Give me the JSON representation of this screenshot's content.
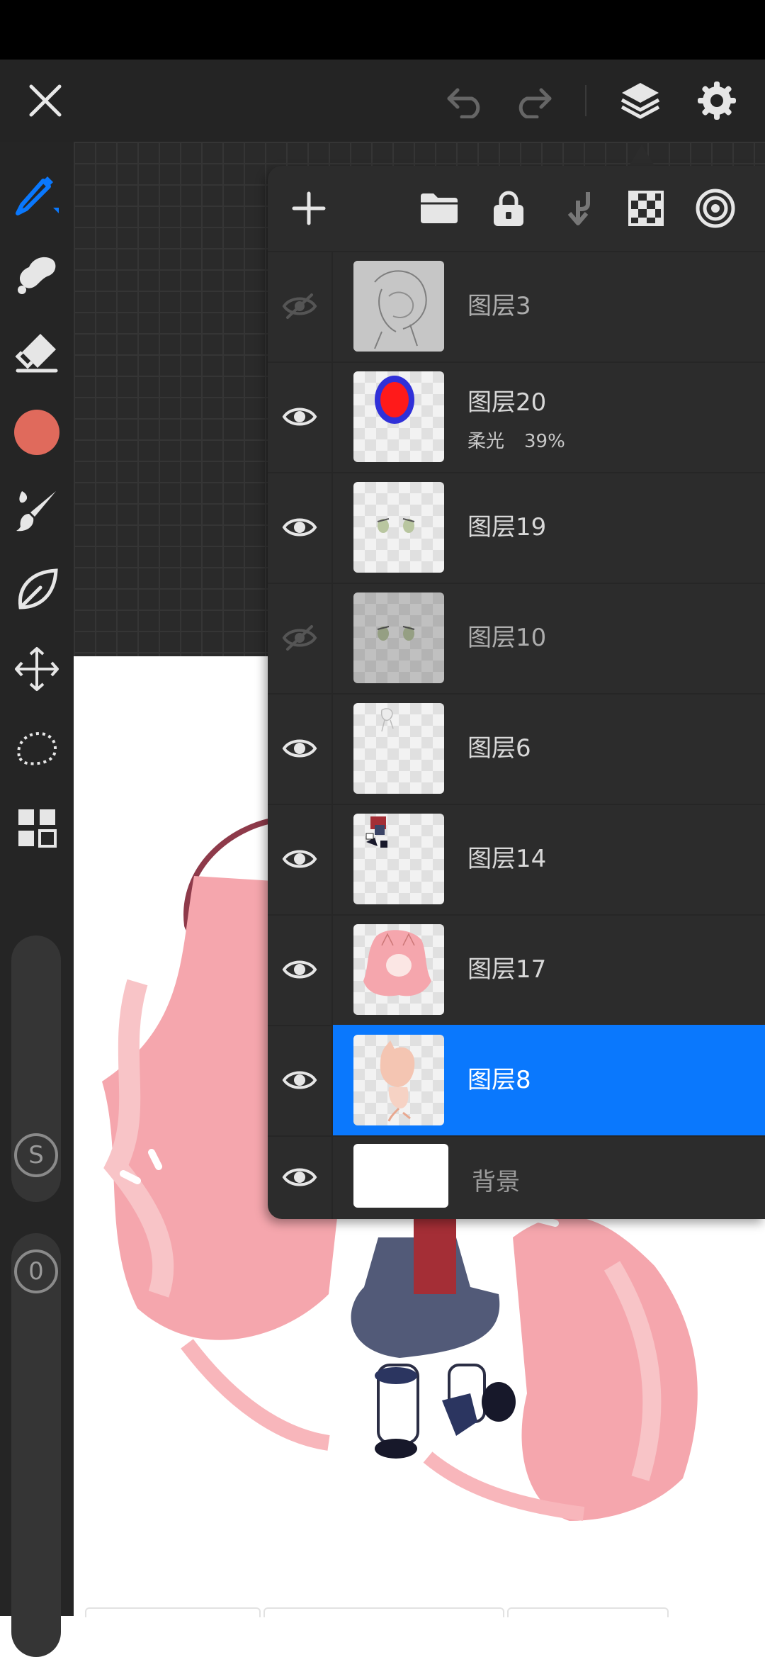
{
  "top_bar": {
    "icons": [
      "close-icon",
      "undo-icon",
      "redo-icon",
      "layers-icon",
      "settings-icon"
    ]
  },
  "left_toolbar": {
    "tools": [
      "pen-icon",
      "smudge-icon",
      "eraser-icon",
      "color-swatch",
      "brush-icon",
      "liquify-icon",
      "move-icon",
      "lasso-icon",
      "gallery-icon"
    ],
    "active_color": "#e06a5c",
    "accent_color": "#0a78fd",
    "size_knob": "S",
    "opacity_knob": "0"
  },
  "layers_panel": {
    "header_icons": [
      "add-icon",
      "folder-icon",
      "lock-icon",
      "merge-down-icon",
      "checker-icon",
      "target-icon"
    ],
    "layers": [
      {
        "name": "图层3",
        "visible": false
      },
      {
        "name": "图层20",
        "visible": true,
        "blend": "柔光",
        "opacity": "39%"
      },
      {
        "name": "图层19",
        "visible": true
      },
      {
        "name": "图层10",
        "visible": false
      },
      {
        "name": "图层6",
        "visible": true
      },
      {
        "name": "图层14",
        "visible": true
      },
      {
        "name": "图层17",
        "visible": true
      },
      {
        "name": "图层8",
        "visible": true,
        "selected": true
      },
      {
        "name": "背景",
        "visible": true,
        "background": true
      }
    ]
  }
}
